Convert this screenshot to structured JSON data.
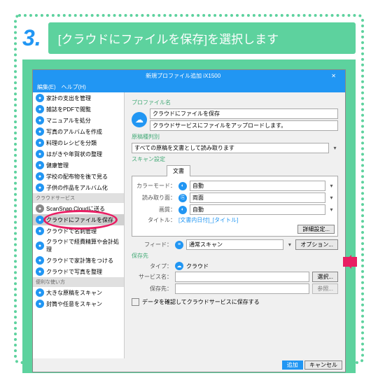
{
  "step": {
    "num": "3.",
    "text": "[クラウドにファイルを保存]を選択します"
  },
  "w": {
    "title": "新規プロファイル追加 iX1500",
    "close": "✕",
    "menu": "編集(E)　ヘルプ(H)"
  },
  "side": {
    "cat1": "クラウドサービス",
    "cat2": "便利な使い方",
    "a": [
      "家計の支出を管理",
      "雑誌をPDFで閲覧",
      "マニュアルを処分",
      "写真のアルバムを作成",
      "料理のレシピを分類",
      "はがきや年賀状の整理",
      "健康管理",
      "学校の配布物を後で見る",
      "子供の作品をアルバム化"
    ],
    "b": [
      "ScanSnap Cloudに送る",
      "クラウドにファイルを保存",
      "クラウドで名刺管理",
      "クラウドで経費精算や会計処理",
      "クラウドで家計簿をつける",
      "クラウドで写真を整理"
    ],
    "c": [
      "大きな原稿をスキャン",
      "封筒や任意をスキャン"
    ]
  },
  "m": {
    "prof": "プロファイル名",
    "name": "クラウドにファイルを保存",
    "desc": "クラウドサービスにファイルをアップロードします。",
    "gk": "原稿種判別",
    "gkv": "すべての原稿を文書として読み取ります",
    "scan": "スキャン設定",
    "tab": "文書",
    "cm": "カラーモード：",
    "cmv": "自動",
    "ym": "読み取り面：",
    "ymv": "両面",
    "gs": "画質：",
    "gsv": "自動",
    "tt": "タイトル：",
    "ttv": "[文書内日付]_[タイトル]",
    "det": "詳細設定...",
    "fd": "フィード：",
    "fdv": "通常スキャン",
    "opt": "オプション...",
    "hs": "保存先",
    "tp": "タイプ：",
    "tpv": "クラウド",
    "sv": "サービス名：",
    "sel": "選択...",
    "ref": "参照...",
    "hd": "保存先：",
    "chk": "データを確認してクラウドサービスに保存する",
    "add": "追加",
    "cancel": "キャンセル",
    "ic": "☁"
  }
}
